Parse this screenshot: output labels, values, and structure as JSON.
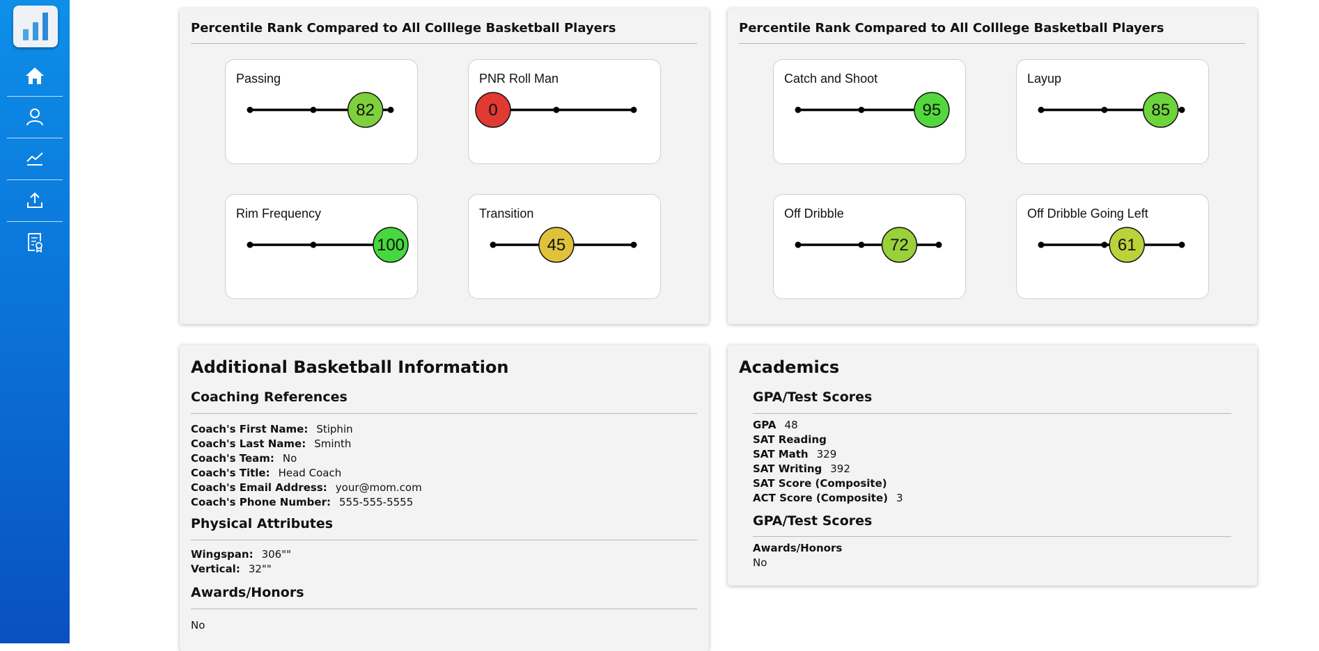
{
  "nav": {
    "items": [
      {
        "name": "home",
        "icon": "home-icon"
      },
      {
        "name": "profile",
        "icon": "user-icon"
      },
      {
        "name": "stats",
        "icon": "trend-chart-icon"
      },
      {
        "name": "upload",
        "icon": "upload-icon"
      },
      {
        "name": "resume",
        "icon": "certificate-document-icon"
      }
    ]
  },
  "percentile_panels": [
    {
      "title": "Percentile Rank Compared to All Colllege Basketball Players",
      "cards": [
        {
          "label": "Passing",
          "value": 82,
          "color": "#7ed13c"
        },
        {
          "label": "PNR Roll Man",
          "value": 0,
          "color": "#e03a32"
        },
        {
          "label": "Rim Frequency",
          "value": 100,
          "color": "#46d83c"
        },
        {
          "label": "Transition",
          "value": 45,
          "color": "#e0c23a"
        }
      ]
    },
    {
      "title": "Percentile Rank Compared to All Colllege Basketball Players",
      "cards": [
        {
          "label": "Catch and Shoot",
          "value": 95,
          "color": "#52d83c"
        },
        {
          "label": "Layup",
          "value": 85,
          "color": "#6dd43c"
        },
        {
          "label": "Off Dribble",
          "value": 72,
          "color": "#9ad03a"
        },
        {
          "label": "Off Dribble Going Left",
          "value": 61,
          "color": "#bcd23a"
        }
      ]
    }
  ],
  "additional": {
    "title": "Additional Basketball Information",
    "coaching": {
      "heading": "Coaching References",
      "rows": [
        {
          "k": "Coach's First Name:",
          "v": "Stiphin"
        },
        {
          "k": "Coach's Last Name:",
          "v": "Sminth"
        },
        {
          "k": "Coach's Team:",
          "v": "No"
        },
        {
          "k": "Coach's Title:",
          "v": "Head Coach"
        },
        {
          "k": "Coach's Email Address:",
          "v": "your@mom.com"
        },
        {
          "k": "Coach's Phone Number:",
          "v": "555-555-5555"
        }
      ]
    },
    "physical": {
      "heading": "Physical Attributes",
      "rows": [
        {
          "k": "Wingspan:",
          "v": "306\"\""
        },
        {
          "k": "Vertical:",
          "v": "32\"\""
        }
      ]
    },
    "awards": {
      "heading": "Awards/Honors",
      "value": "No"
    }
  },
  "academics": {
    "title": "Academics",
    "gpa_heading": "GPA/Test Scores",
    "rows": [
      {
        "k": "GPA",
        "v": "48"
      },
      {
        "k": "SAT Reading",
        "v": ""
      },
      {
        "k": "SAT Math",
        "v": "329"
      },
      {
        "k": "SAT Writing",
        "v": "392"
      },
      {
        "k": "SAT Score (Composite)",
        "v": ""
      },
      {
        "k": "ACT Score (Composite)",
        "v": "3"
      }
    ],
    "second_heading": "GPA/Test Scores",
    "awards_label": "Awards/Honors",
    "awards_value": "No"
  }
}
